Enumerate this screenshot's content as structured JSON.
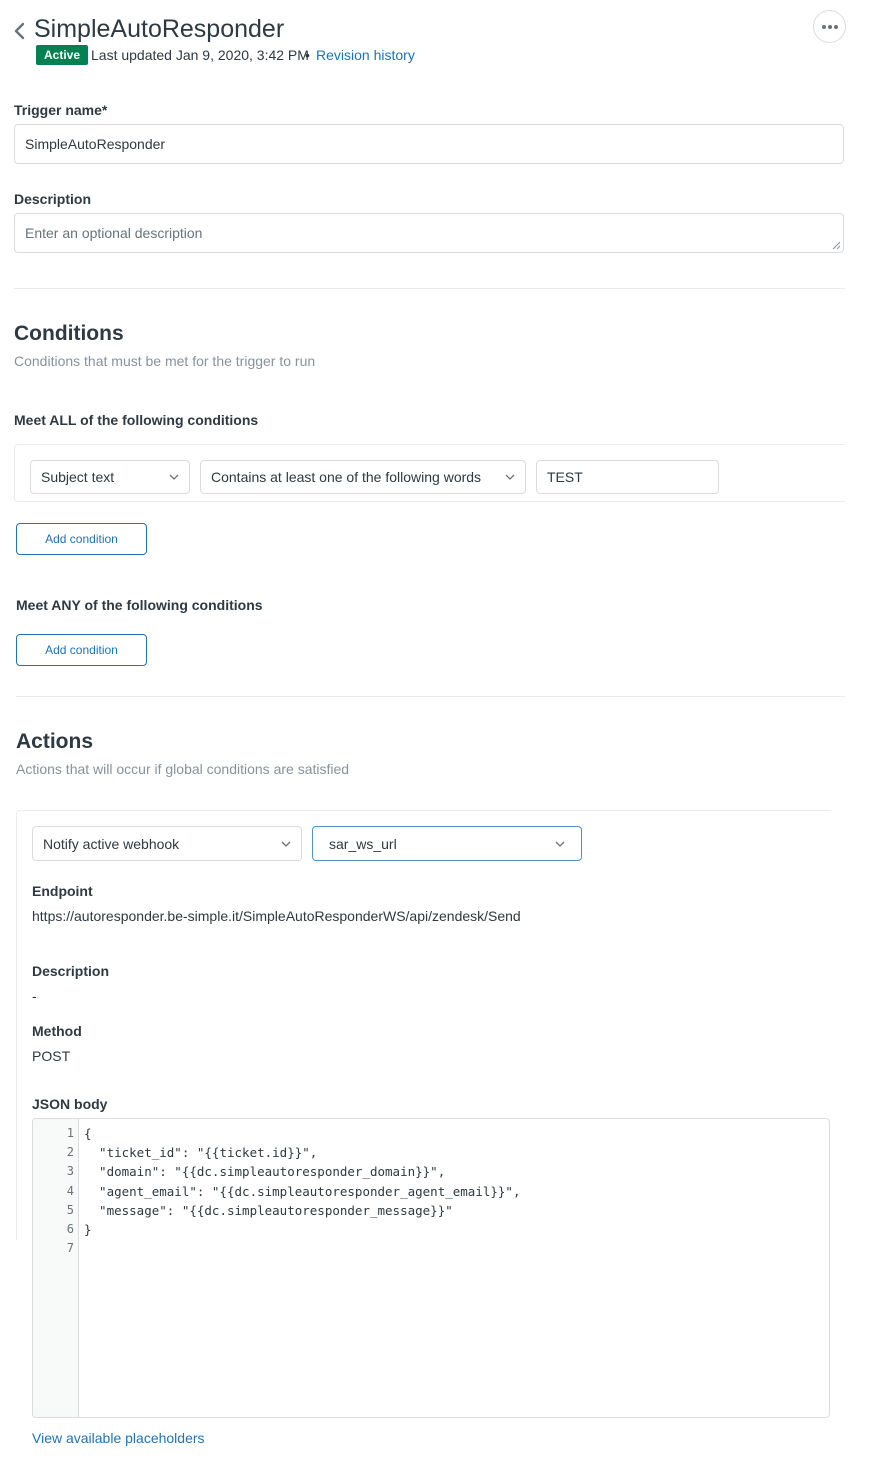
{
  "header": {
    "title": "SimpleAutoResponder",
    "status": "Active",
    "last_updated": "Last updated Jan 9, 2020, 3:42 PM",
    "bullet": "•",
    "revision_link": "Revision history"
  },
  "form": {
    "trigger_name_label": "Trigger name*",
    "trigger_name_value": "SimpleAutoResponder",
    "description_label": "Description",
    "description_placeholder": "Enter an optional description"
  },
  "conditions": {
    "title": "Conditions",
    "subtitle": "Conditions that must be met for the trigger to run",
    "all_label": "Meet ALL of the following conditions",
    "all_rows": [
      {
        "field": "Subject text",
        "operator": "Contains at least one of the following words",
        "value": "TEST"
      }
    ],
    "add_condition_all": "Add condition",
    "any_label": "Meet ANY of the following conditions",
    "add_condition_any": "Add condition"
  },
  "actions": {
    "title": "Actions",
    "subtitle": "Actions that will occur if global conditions are satisfied",
    "action_select": "Notify active webhook",
    "webhook_select": "sar_ws_url",
    "endpoint_label": "Endpoint",
    "endpoint_value": "https://autoresponder.be-simple.it/SimpleAutoResponderWS/api/zendesk/Send",
    "description_label": "Description",
    "description_value": "-",
    "method_label": "Method",
    "method_value": "POST",
    "json_body_label": "JSON body",
    "json_lines": [
      "{",
      "  \"ticket_id\": \"{{ticket.id}}\",",
      "  \"domain\": \"{{dc.simpleautoresponder_domain}}\",",
      "  \"agent_email\": \"{{dc.simpleautoresponder_agent_email}}\",",
      "  \"message\": \"{{dc.simpleautoresponder_message}}\"",
      "}",
      ""
    ],
    "line_numbers": [
      "1",
      "2",
      "3",
      "4",
      "5",
      "6",
      "7"
    ],
    "placeholders_link": "View available placeholders"
  },
  "colors": {
    "active_badge": "#038153",
    "link": "#1f73b7",
    "text": "#2f3941",
    "muted": "#87929d"
  }
}
